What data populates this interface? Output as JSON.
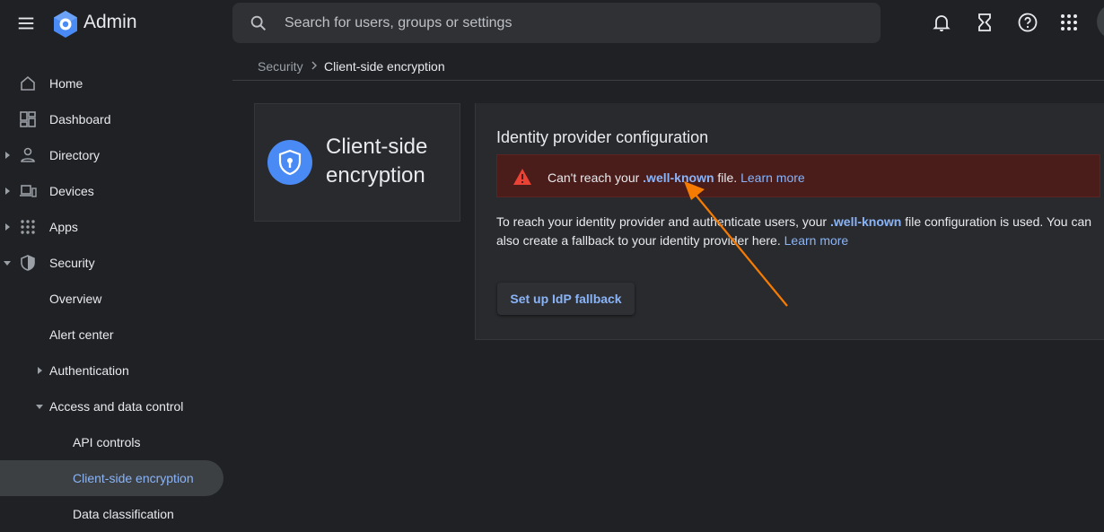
{
  "app": {
    "title": "Admin"
  },
  "search": {
    "placeholder": "Search for users, groups or settings"
  },
  "sidebar": {
    "items": [
      {
        "label": "Home"
      },
      {
        "label": "Dashboard"
      },
      {
        "label": "Directory"
      },
      {
        "label": "Devices"
      },
      {
        "label": "Apps"
      },
      {
        "label": "Security"
      },
      {
        "label": "Overview"
      },
      {
        "label": "Alert center"
      },
      {
        "label": "Authentication"
      },
      {
        "label": "Access and data control"
      },
      {
        "label": "API controls"
      },
      {
        "label": "Client-side encryption"
      },
      {
        "label": "Data classification"
      }
    ]
  },
  "breadcrumb": {
    "parent": "Security",
    "current": "Client-side encryption"
  },
  "summary_card": {
    "title": "Client-side encryption"
  },
  "idp": {
    "title": "Identity provider configuration",
    "alert": {
      "prefix": "Can't reach your",
      "file": ".well-known",
      "suffix": "file.",
      "link": "Learn more"
    },
    "description": {
      "part1": "To reach your identity provider and authenticate users, your",
      "file": ".well-known",
      "part2": "file configuration is used. You can also create a fallback to your identity provider here.",
      "link": "Learn more"
    },
    "button_label": "Set up IdP fallback"
  },
  "colors": {
    "background": "#202124",
    "card": "#292a2d",
    "link": "#8ab4f8",
    "alert_bg": "#4a1c1a",
    "alert_icon": "#ea4335",
    "annotation_arrow": "#f57c00",
    "logo_blue": "#4a8af4"
  },
  "icons": {
    "menu": "menu-icon",
    "logo": "admin-logo-icon",
    "search": "search-icon",
    "notifications": "bell-icon",
    "tasks": "hourglass-icon",
    "help": "help-icon",
    "apps": "apps-grid-icon"
  }
}
